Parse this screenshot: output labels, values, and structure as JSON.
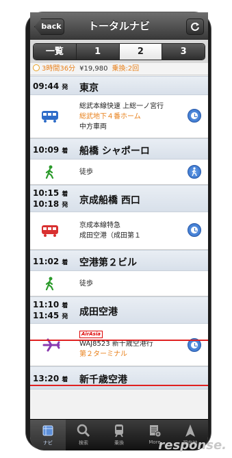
{
  "navbar": {
    "back_label": "back",
    "title": "トータルナビ",
    "refresh_icon": "refresh-icon"
  },
  "segments": [
    "一覧",
    "1",
    "2",
    "3"
  ],
  "summary": {
    "duration": "3時間36分",
    "fare": "¥19,980",
    "transfers": "乗換:2回"
  },
  "stations": [
    {
      "time1": "09:44",
      "mark1": "発",
      "name": "東京"
    },
    {
      "time1": "10:09",
      "mark1": "着",
      "name": "船橋 シャポーロ"
    },
    {
      "time1": "10:15",
      "mark1": "着",
      "time2": "10:18",
      "mark2": "発",
      "name": "京成船橋 西口"
    },
    {
      "time1": "11:02",
      "mark1": "着",
      "name": "空港第２ビル"
    },
    {
      "time1": "11:10",
      "mark1": "着",
      "time2": "11:45",
      "mark2": "発",
      "name": "成田空港"
    },
    {
      "time1": "13:20",
      "mark1": "着",
      "name": "新千歳空港"
    }
  ],
  "routes": [
    {
      "line1": "総武本線快速 上総一ノ宮行",
      "line2": "総武地下４番ホーム",
      "line3": "中方車両",
      "icon": "train-icon"
    },
    {
      "line1": "徒歩",
      "icon": "walk-icon"
    },
    {
      "line1": "京成本線特急",
      "line2": "成田空港（成田第１",
      "icon": "train-icon"
    },
    {
      "line1": "徒歩",
      "icon": "walk-icon"
    },
    {
      "brand": "AirAsia",
      "line1": "WAJ8523 新千歳空港行",
      "line2": "第２ターミナル",
      "icon": "plane-icon"
    }
  ],
  "tabs": [
    "ナビ",
    "検索",
    "乗換",
    "More",
    "現在地"
  ],
  "watermark": "response."
}
